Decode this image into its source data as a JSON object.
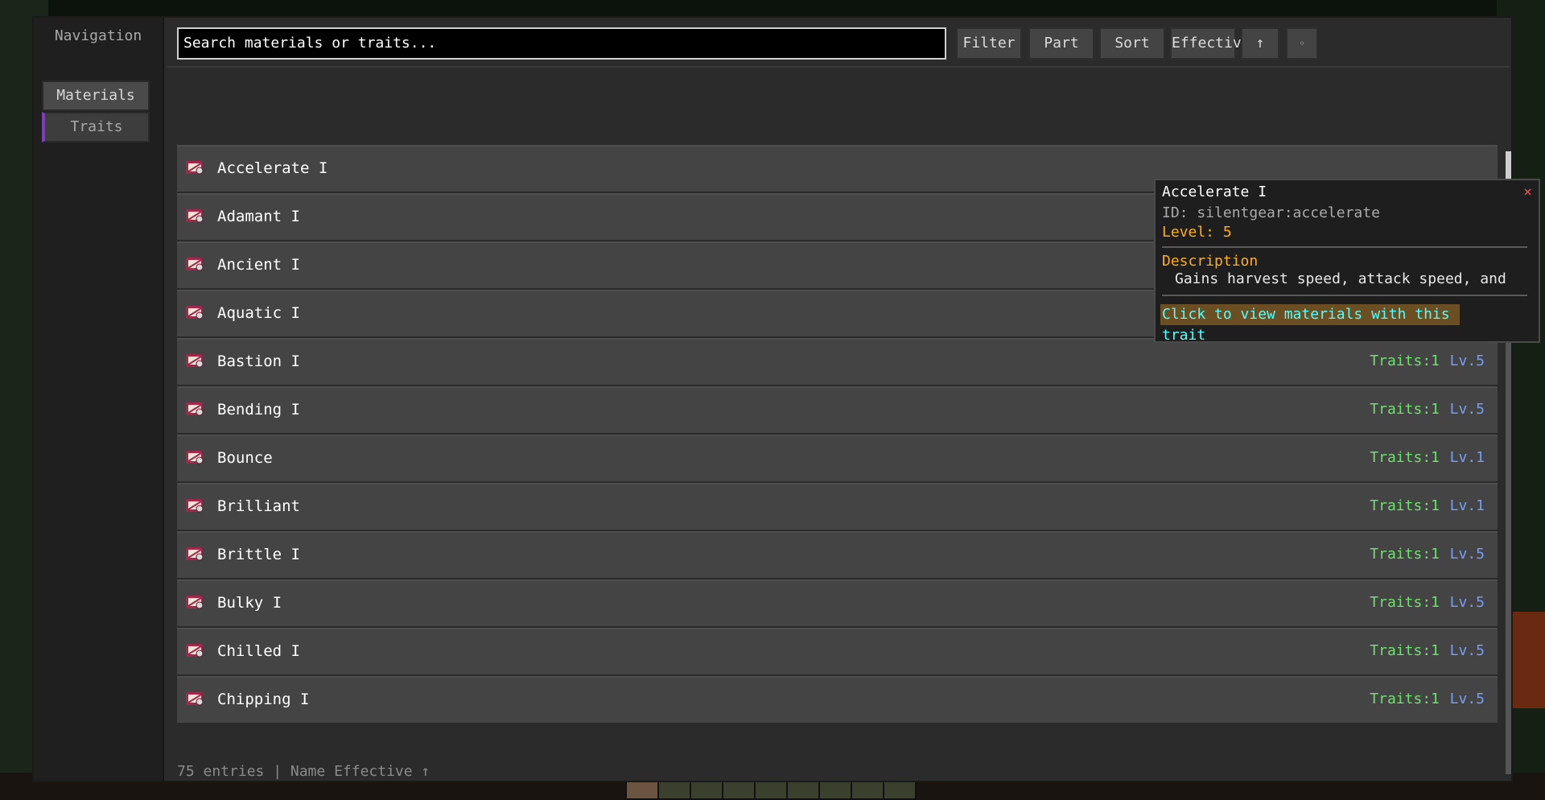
{
  "nav": {
    "title": "Navigation",
    "items": [
      {
        "label": "Materials",
        "active": false
      },
      {
        "label": "Traits",
        "active": true
      }
    ]
  },
  "toolbar": {
    "search_value": "Search materials or traits...",
    "filter_label": "Filter",
    "part_label": "Part",
    "sort_label": "Sort",
    "effective_label": "Effective",
    "direction_label": "↑",
    "settings_label": "◦"
  },
  "rows": [
    {
      "name": "Accelerate I",
      "traits": "",
      "level": ""
    },
    {
      "name": "Adamant I",
      "traits": "",
      "level": ""
    },
    {
      "name": "Ancient I",
      "traits": "",
      "level": ""
    },
    {
      "name": "Aquatic I",
      "traits": "",
      "level": ""
    },
    {
      "name": "Bastion I",
      "traits": "Traits:1",
      "level": "Lv.5"
    },
    {
      "name": "Bending I",
      "traits": "Traits:1",
      "level": "Lv.5"
    },
    {
      "name": "Bounce",
      "traits": "Traits:1",
      "level": "Lv.1"
    },
    {
      "name": "Brilliant",
      "traits": "Traits:1",
      "level": "Lv.1"
    },
    {
      "name": "Brittle I",
      "traits": "Traits:1",
      "level": "Lv.5"
    },
    {
      "name": "Bulky I",
      "traits": "Traits:1",
      "level": "Lv.5"
    },
    {
      "name": "Chilled I",
      "traits": "Traits:1",
      "level": "Lv.5"
    },
    {
      "name": "Chipping I",
      "traits": "Traits:1",
      "level": "Lv.5"
    }
  ],
  "status": "75 entries | Name Effective ↑",
  "tooltip": {
    "title": "Accelerate I",
    "close": "×",
    "id": "ID: silentgear:accelerate",
    "level": "Level: 5",
    "description_label": "Description",
    "description": "Gains harvest speed, attack speed, and",
    "link": "Click to view materials with this trait"
  },
  "colors": {
    "traits_count": "#6fe06f",
    "level": "#7a9cf0",
    "accent": "#7e3bbf",
    "tooltip_highlight": "#ffae1a",
    "link": "#55ffff"
  }
}
